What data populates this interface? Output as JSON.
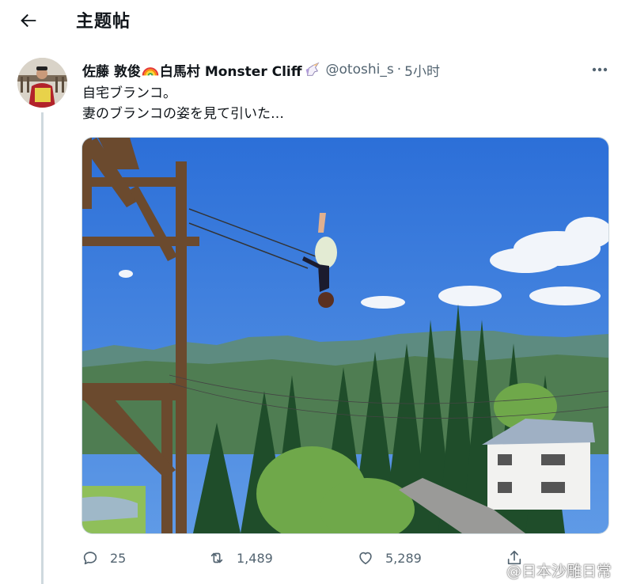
{
  "header": {
    "title": "主题帖"
  },
  "tweet": {
    "author_name": "佐藤 敦俊",
    "author_location": "白馬村 Monster Cliff",
    "handle": "@otoshi_s",
    "separator": "·",
    "time": "5小时",
    "text_line1": "自宅ブランコ。",
    "text_line2": "妻のブランコの姿を見て引いた…"
  },
  "actions": {
    "reply_count": "25",
    "retweet_count": "1,489",
    "like_count": "5,289"
  },
  "watermark": {
    "text": "@日本沙雕日常"
  },
  "icons": {
    "back": "arrow-left-icon",
    "more": "more-horizontal-icon",
    "reply": "reply-icon",
    "retweet": "retweet-icon",
    "like": "heart-icon",
    "share": "share-icon",
    "rainbow": "rainbow-emoji-icon",
    "unicorn": "unicorn-emoji-icon",
    "weibo": "weibo-logo-icon"
  },
  "colors": {
    "text": "#0f1419",
    "secondary": "#536471",
    "sky": "#2f6fd6"
  }
}
